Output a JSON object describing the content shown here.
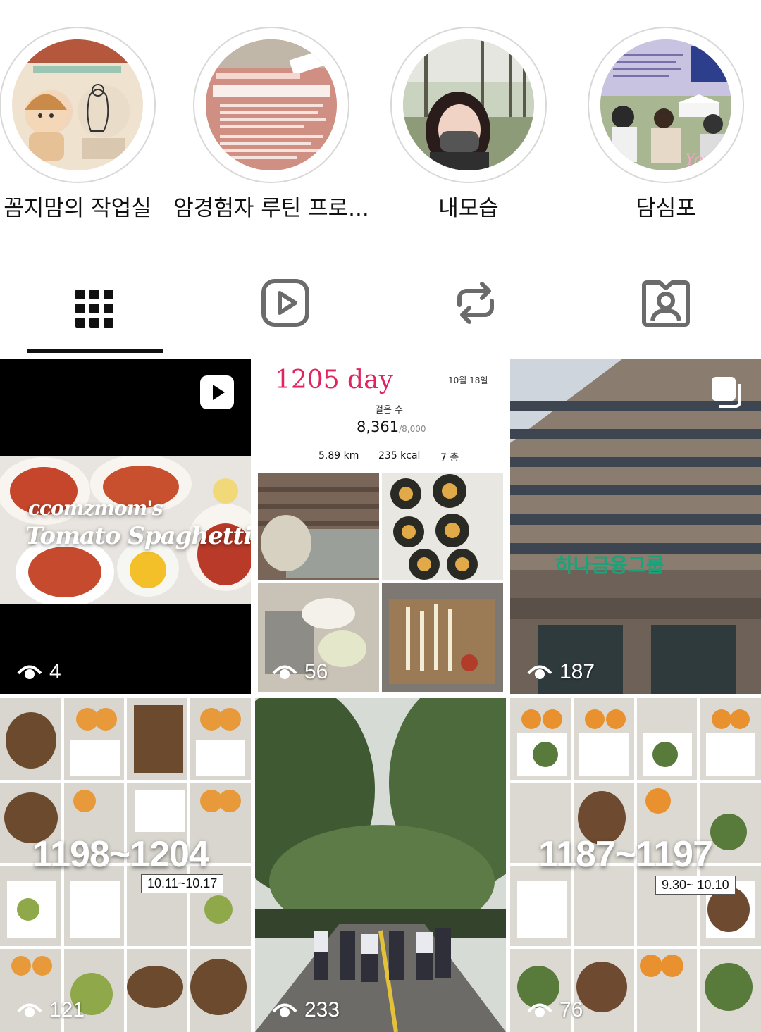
{
  "highlights": [
    {
      "label": "꼼지맘의 작업실"
    },
    {
      "label": "암경험자 루틴 프로..."
    },
    {
      "label": "내모습"
    },
    {
      "label": "담심포"
    }
  ],
  "tabs": [
    {
      "name": "posts-grid",
      "icon": "grid-icon",
      "active": true
    },
    {
      "name": "reels",
      "icon": "reels-play-icon",
      "active": false
    },
    {
      "name": "reposts",
      "icon": "repost-icon",
      "active": false
    },
    {
      "name": "tagged",
      "icon": "tagged-person-icon",
      "active": false
    }
  ],
  "posts": [
    {
      "views": "4",
      "type": "reel",
      "overlay1": "ccomzmom's",
      "overlay2": "Tomato Spaghetti"
    },
    {
      "views": "56",
      "type": "post",
      "title": "1205 day",
      "date": "10월 18일",
      "steps_label": "걸음 수",
      "steps": "8,361",
      "steps_goal": "/8,000",
      "km": "5.89 km",
      "kcal": "235 kcal",
      "floors": "7 층"
    },
    {
      "views": "187",
      "type": "carousel",
      "sign": "하나금융그룹"
    },
    {
      "views": "121",
      "type": "post",
      "range": "1198~1204",
      "dates": "10.11~10.17"
    },
    {
      "views": "233",
      "type": "post"
    },
    {
      "views": "76",
      "type": "post",
      "range": "1187~1197",
      "dates": "9.30~ 10.10"
    }
  ],
  "colors": {
    "accent_pink": "#e0245e",
    "tab_icon": "#6b6b6b",
    "active_tab": "#111111"
  }
}
